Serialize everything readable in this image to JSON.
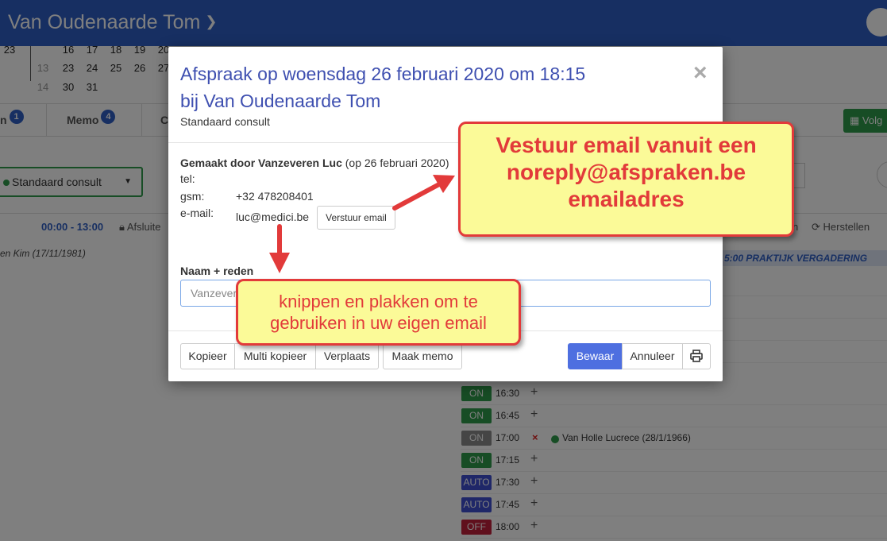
{
  "header": {
    "title": "Van Oudenaarde Tom"
  },
  "calendar": {
    "rows": [
      {
        "week": "",
        "days": [
          "23",
          "16",
          "17",
          "18",
          "19",
          "20"
        ]
      },
      {
        "week": "13",
        "days": [
          "23",
          "24",
          "25",
          "26",
          "27"
        ]
      },
      {
        "week": "14",
        "days": [
          "30",
          "31"
        ]
      }
    ]
  },
  "tabs": {
    "first_label": "n",
    "first_badge": "1",
    "memo_label": "Memo",
    "memo_badge": "4",
    "third_label": "C",
    "next_label": "Volg"
  },
  "agenda": {
    "type_select": "Standaard consult",
    "time_range": "00:00 - 13:00",
    "lock_label": "Afsluite",
    "m_label": "n",
    "restore_label": "Herstellen",
    "patient_left": "en Kim (17/11/1981)",
    "meeting_banner": "5:00 PRAKTIJK VERGADERING",
    "slots": [
      {
        "status": "ON",
        "color": "#2e9b4a",
        "time": "16:30",
        "action": "+"
      },
      {
        "status": "ON",
        "color": "#2e9b4a",
        "time": "16:45",
        "action": "+"
      },
      {
        "status": "ON",
        "color": "#8a8a8a",
        "time": "17:00",
        "action": "×",
        "patient": "Van Holle Lucrece (28/1/1966)"
      },
      {
        "status": "ON",
        "color": "#2e9b4a",
        "time": "17:15",
        "action": "+"
      },
      {
        "status": "AUTO",
        "color": "#3e4fd0",
        "time": "17:30",
        "action": "+"
      },
      {
        "status": "AUTO",
        "color": "#3e4fd0",
        "time": "17:45",
        "action": "+"
      },
      {
        "status": "OFF",
        "color": "#c0213a",
        "time": "18:00",
        "action": "+"
      }
    ]
  },
  "modal": {
    "title_line1": "Afspraak op woensdag 26 februari 2020 om 18:15",
    "title_line2": "bij Van Oudenaarde Tom",
    "subtitle": "Standaard consult",
    "close": "×",
    "made_by_label": "Gemaakt door Vanzeveren Luc",
    "made_by_date": "(op 26 februari 2020)",
    "tel_label": "tel:",
    "tel_value": "",
    "gsm_label": "gsm:",
    "gsm_value": "+32 478208401",
    "email_label": "e-mail:",
    "email_value": "luc@medici.be",
    "send_email_button": "Verstuur email",
    "name_label": "Naam + reden",
    "name_value": "Vanzeveren",
    "buttons": {
      "kopieer": "Kopieer",
      "multi_kopieer": "Multi kopieer",
      "verplaats": "Verplaats",
      "maak_memo": "Maak memo",
      "bewaar": "Bewaar",
      "annuleer": "Annuleer"
    }
  },
  "callouts": {
    "email": [
      "Vestuur email vanuit een",
      "noreply@afspraken.be",
      "emailadres"
    ],
    "copy": [
      "knippen en plakken om te",
      "gebruiken in uw eigen email"
    ]
  },
  "colors": {
    "header": "#2f5fc4",
    "primary_button": "#4e6fe0",
    "callout_border": "#e23a3a",
    "callout_fill": "#fbfa98"
  }
}
